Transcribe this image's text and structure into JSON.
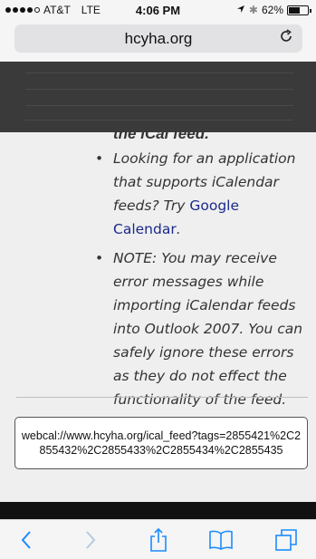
{
  "status_bar": {
    "carrier": "AT&T",
    "network": "LTE",
    "time": "4:06 PM",
    "battery": "62%",
    "battery_level": 0.62
  },
  "browser": {
    "address": "hcyha.org",
    "reload_icon": "reload-icon"
  },
  "content": {
    "partial_heading": "the iCal feed.",
    "bullets": [
      {
        "text_before": "Looking for an application that supports iCalendar feeds? Try ",
        "link": "Google Calendar",
        "text_after": "."
      },
      {
        "text": "NOTE: You may receive error messages while importing iCalendar feeds into Outlook 2007. You can safely ignore these errors as they do not effect the functionality of the feed."
      }
    ],
    "feed_url": "webcal://www.hcyha.org/ical_feed?tags=2855421%2C2855432%2C2855433%2C2855434%2C2855435"
  },
  "toolbar": {
    "back_icon": "chevron-left-icon",
    "forward_icon": "chevron-right-icon",
    "share_icon": "share-icon",
    "bookmarks_icon": "book-icon",
    "tabs_icon": "tabs-icon"
  },
  "colors": {
    "link": "#1a2a8a",
    "accent": "#1a8cff"
  }
}
